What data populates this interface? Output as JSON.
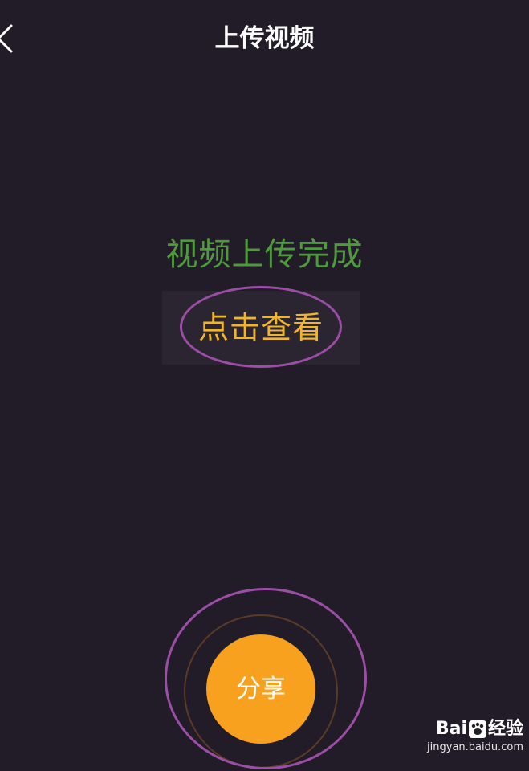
{
  "header": {
    "title": "上传视频",
    "back_icon": "chevron-left-icon"
  },
  "status": {
    "message": "视频上传完成",
    "message_color": "#4e9a3c"
  },
  "view_action": {
    "label": "点击查看",
    "label_color": "#f0b528"
  },
  "share_action": {
    "label": "分享",
    "color": "#f7a11f"
  },
  "annotation": {
    "color": "#9b4ea6"
  },
  "watermark": {
    "brand_left": "Bai",
    "brand_right": "经验",
    "url": "jingyan.baidu.com"
  }
}
